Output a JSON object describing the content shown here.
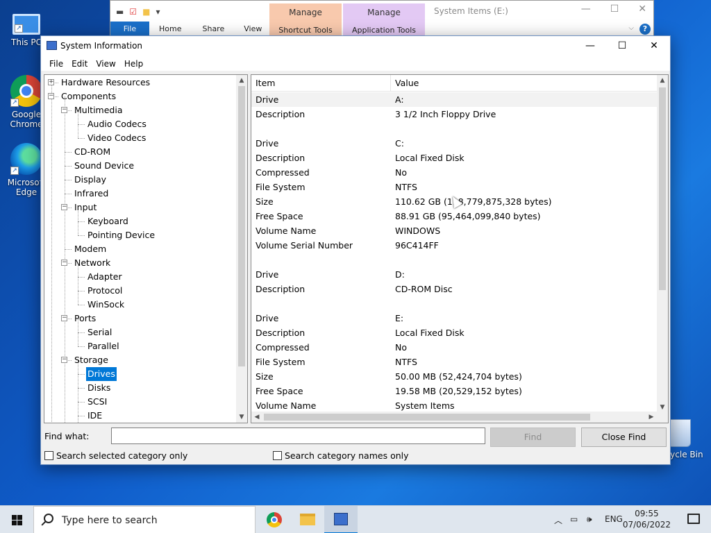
{
  "desktop": {
    "icons": [
      {
        "label": "This PC"
      },
      {
        "label": "Google Chrome"
      },
      {
        "label": "Microsoft Edge"
      },
      {
        "label": "Recycle Bin"
      }
    ]
  },
  "explorer": {
    "title": "System Items (E:)",
    "tabs": [
      "File",
      "Home",
      "Share",
      "View"
    ],
    "manage_shortcut": {
      "title": "Manage",
      "sub": "Shortcut Tools"
    },
    "manage_app": {
      "title": "Manage",
      "sub": "Application Tools"
    }
  },
  "window": {
    "title": "System Information",
    "menu": [
      "File",
      "Edit",
      "View",
      "Help"
    ]
  },
  "tree": {
    "nodes": [
      {
        "label": "Hardware Resources",
        "level": 0,
        "expander": "+"
      },
      {
        "label": "Components",
        "level": 0,
        "expander": "-"
      },
      {
        "label": "Multimedia",
        "level": 1,
        "expander": "-"
      },
      {
        "label": "Audio Codecs",
        "level": 2
      },
      {
        "label": "Video Codecs",
        "level": 2
      },
      {
        "label": "CD-ROM",
        "level": 1
      },
      {
        "label": "Sound Device",
        "level": 1
      },
      {
        "label": "Display",
        "level": 1
      },
      {
        "label": "Infrared",
        "level": 1
      },
      {
        "label": "Input",
        "level": 1,
        "expander": "-"
      },
      {
        "label": "Keyboard",
        "level": 2
      },
      {
        "label": "Pointing Device",
        "level": 2
      },
      {
        "label": "Modem",
        "level": 1
      },
      {
        "label": "Network",
        "level": 1,
        "expander": "-"
      },
      {
        "label": "Adapter",
        "level": 2
      },
      {
        "label": "Protocol",
        "level": 2
      },
      {
        "label": "WinSock",
        "level": 2
      },
      {
        "label": "Ports",
        "level": 1,
        "expander": "-"
      },
      {
        "label": "Serial",
        "level": 2
      },
      {
        "label": "Parallel",
        "level": 2
      },
      {
        "label": "Storage",
        "level": 1,
        "expander": "-"
      },
      {
        "label": "Drives",
        "level": 2,
        "selected": true
      },
      {
        "label": "Disks",
        "level": 2
      },
      {
        "label": "SCSI",
        "level": 2
      },
      {
        "label": "IDE",
        "level": 2
      }
    ]
  },
  "list": {
    "columns": [
      "Item",
      "Value"
    ],
    "rows": [
      {
        "item": "Drive",
        "value": "A:",
        "selected": true
      },
      {
        "item": "Description",
        "value": "3 1/2 Inch Floppy Drive"
      },
      {
        "item": "",
        "value": ""
      },
      {
        "item": "Drive",
        "value": "C:"
      },
      {
        "item": "Description",
        "value": "Local Fixed Disk"
      },
      {
        "item": "Compressed",
        "value": "No"
      },
      {
        "item": "File System",
        "value": "NTFS"
      },
      {
        "item": "Size",
        "value": "110.62 GB (118,779,875,328 bytes)"
      },
      {
        "item": "Free Space",
        "value": "88.91 GB (95,464,099,840 bytes)"
      },
      {
        "item": "Volume Name",
        "value": "WINDOWS"
      },
      {
        "item": "Volume Serial Number",
        "value": "96C414FF"
      },
      {
        "item": "",
        "value": ""
      },
      {
        "item": "Drive",
        "value": "D:"
      },
      {
        "item": "Description",
        "value": "CD-ROM Disc"
      },
      {
        "item": "",
        "value": ""
      },
      {
        "item": "Drive",
        "value": "E:"
      },
      {
        "item": "Description",
        "value": "Local Fixed Disk"
      },
      {
        "item": "Compressed",
        "value": "No"
      },
      {
        "item": "File System",
        "value": "NTFS"
      },
      {
        "item": "Size",
        "value": "50.00 MB (52,424,704 bytes)"
      },
      {
        "item": "Free Space",
        "value": "19.58 MB (20,529,152 bytes)"
      },
      {
        "item": "Volume Name",
        "value": "System Items"
      }
    ]
  },
  "find": {
    "label": "Find what:",
    "value": "",
    "find_button": "Find",
    "close_button": "Close Find",
    "search_selected": "Search selected category only",
    "search_names": "Search category names only"
  },
  "taskbar": {
    "search_placeholder": "Type here to search",
    "language": "ENG",
    "time": "09:55",
    "date": "07/06/2022"
  },
  "colors": {
    "selection": "#0078d7",
    "desktop": "#0f5bc9"
  }
}
